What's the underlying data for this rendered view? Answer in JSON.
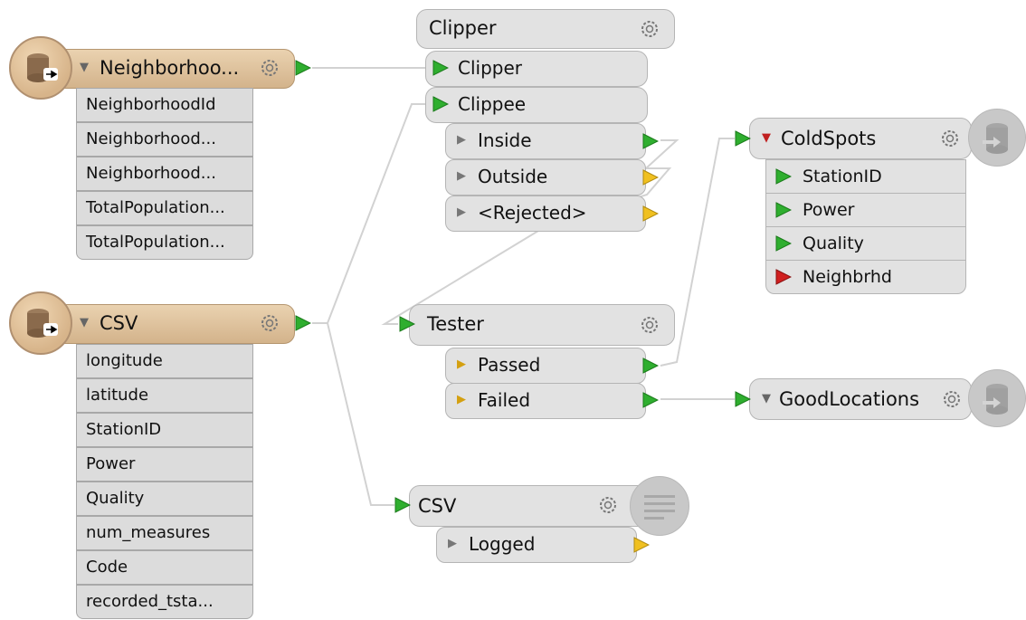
{
  "readers": {
    "neighborhood": {
      "title": "Neighborhoo...",
      "attributes": [
        "NeighborhoodId",
        "Neighborhood...",
        "Neighborhood...",
        "TotalPopulation...",
        "TotalPopulation..."
      ]
    },
    "csv": {
      "title": "CSV",
      "attributes": [
        "longitude",
        "latitude",
        "StationID",
        "Power",
        "Quality",
        "num_measures",
        "Code",
        "recorded_tsta..."
      ]
    }
  },
  "transformers": {
    "clipper": {
      "title": "Clipper",
      "inputs": [
        "Clipper",
        "Clippee"
      ],
      "outputs": [
        "Inside",
        "Outside",
        "<Rejected>"
      ]
    },
    "tester": {
      "title": "Tester",
      "outputs": [
        "Passed",
        "Failed"
      ]
    },
    "logger": {
      "title": "CSV",
      "outputs": [
        "Logged"
      ]
    }
  },
  "writers": {
    "coldspots": {
      "title": "ColdSpots",
      "attributes": [
        "StationID",
        "Power",
        "Quality",
        "Neighbrhd"
      ]
    },
    "goodlocations": {
      "title": "GoodLocations"
    }
  },
  "colors": {
    "reader_fill": "#d7b48a",
    "transformer_fill": "#e2e2e2",
    "port_green": "#2fae2f",
    "port_yellow": "#f0c020",
    "port_red": "#d02020",
    "wire": "#d0d0d0"
  }
}
